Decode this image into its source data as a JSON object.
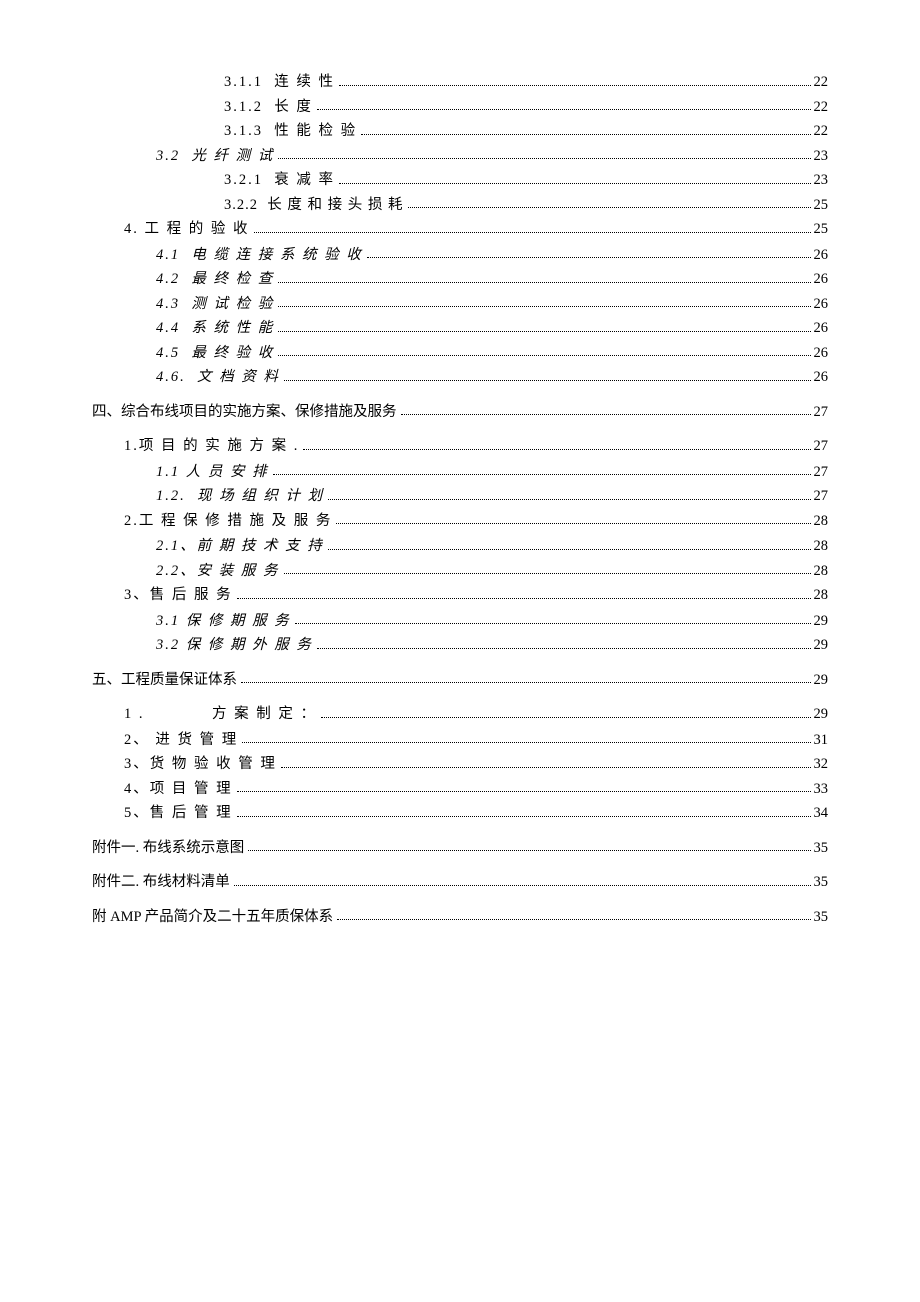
{
  "entries": [
    {
      "label": "3.1.1  连 续 性",
      "page": "22",
      "indent": 3,
      "italic": false,
      "section": false,
      "sp": "sp2"
    },
    {
      "label": "3.1.2  长 度",
      "page": "22",
      "indent": 3,
      "italic": false,
      "section": false,
      "sp": "sp2"
    },
    {
      "label": "3.1.3  性 能 检 验",
      "page": "22",
      "indent": 3,
      "italic": false,
      "section": false,
      "sp": "sp2"
    },
    {
      "label": "3.2  光 纤 测 试",
      "page": "23",
      "indent": 2,
      "italic": true,
      "section": false,
      "sp": "sp2"
    },
    {
      "label": "3.2.1  衰 减 率",
      "page": "23",
      "indent": 3,
      "italic": false,
      "section": false,
      "sp": "sp2"
    },
    {
      "label": "3.2.2  长 度 和 接 头 损 耗",
      "page": "25",
      "indent": 3,
      "italic": false,
      "section": false,
      "sp": "sp1"
    },
    {
      "label": "4. 工 程 的 验 收",
      "page": "25",
      "indent": 1,
      "italic": false,
      "section": false,
      "sp": "sp2",
      "group": true
    },
    {
      "label": "4.1  电 缆 连 接 系 统 验 收",
      "page": "26",
      "indent": 2,
      "italic": true,
      "section": false,
      "sp": "sp2"
    },
    {
      "label": "4.2  最 终 检 查",
      "page": "26",
      "indent": 2,
      "italic": true,
      "section": false,
      "sp": "sp2"
    },
    {
      "label": "4.3  测 试 检 验",
      "page": "26",
      "indent": 2,
      "italic": true,
      "section": false,
      "sp": "sp2"
    },
    {
      "label": "4.4  系 统 性 能",
      "page": "26",
      "indent": 2,
      "italic": true,
      "section": false,
      "sp": "sp2"
    },
    {
      "label": "4.5  最 终 验 收",
      "page": "26",
      "indent": 2,
      "italic": true,
      "section": false,
      "sp": "sp2"
    },
    {
      "label": "4.6.  文 档 资 料",
      "page": "26",
      "indent": 2,
      "italic": true,
      "section": false,
      "sp": "sp2"
    },
    {
      "label": "四、综合布线项目的实施方案、保修措施及服务",
      "page": "27",
      "indent": 0,
      "italic": false,
      "section": true,
      "sp": ""
    },
    {
      "label": "1.项 目 的 实 施 方 案 .",
      "page": "27",
      "indent": 1,
      "italic": false,
      "section": false,
      "sp": "sp2",
      "group": true
    },
    {
      "label": "1.1 人 员 安 排",
      "page": "27",
      "indent": 2,
      "italic": true,
      "section": false,
      "sp": "sp2"
    },
    {
      "label": "1.2.  现 场 组 织 计 划",
      "page": "27",
      "indent": 2,
      "italic": true,
      "section": false,
      "sp": "sp2"
    },
    {
      "label": "2.工 程 保 修 措 施 及 服 务",
      "page": "28",
      "indent": 1,
      "italic": false,
      "section": false,
      "sp": "sp2",
      "group": true
    },
    {
      "label": "2.1、前 期 技 术 支 持",
      "page": "28",
      "indent": 2,
      "italic": true,
      "section": false,
      "sp": "sp2"
    },
    {
      "label": "2.2、安 装 服 务",
      "page": "28",
      "indent": 2,
      "italic": true,
      "section": false,
      "sp": "sp2"
    },
    {
      "label": "3、售 后 服 务",
      "page": "28",
      "indent": 1,
      "italic": false,
      "section": false,
      "sp": "sp2",
      "group": true
    },
    {
      "label": "3.1 保 修 期 服 务",
      "page": "29",
      "indent": 2,
      "italic": true,
      "section": false,
      "sp": "sp2"
    },
    {
      "label": "3.2 保 修 期 外 服 务",
      "page": "29",
      "indent": 2,
      "italic": true,
      "section": false,
      "sp": "sp2"
    },
    {
      "label": "五、工程质量保证体系",
      "page": "29",
      "indent": 0,
      "italic": false,
      "section": true,
      "sp": ""
    },
    {
      "label": "1 .            方 案 制 定 ：",
      "page": "29",
      "indent": 1,
      "italic": false,
      "section": false,
      "sp": "sp2",
      "group": true
    },
    {
      "label": "2、 进 货 管 理",
      "page": "31",
      "indent": 1,
      "italic": false,
      "section": false,
      "sp": "sp2"
    },
    {
      "label": "3、货 物 验 收 管 理",
      "page": "32",
      "indent": 1,
      "italic": false,
      "section": false,
      "sp": "sp2"
    },
    {
      "label": "4、项 目 管 理",
      "page": "33",
      "indent": 1,
      "italic": false,
      "section": false,
      "sp": "sp2"
    },
    {
      "label": "5、售 后 管 理",
      "page": "34",
      "indent": 1,
      "italic": false,
      "section": false,
      "sp": "sp2"
    },
    {
      "label": "附件一. 布线系统示意图",
      "page": "35",
      "indent": 0,
      "italic": false,
      "section": true,
      "sp": ""
    },
    {
      "label": "附件二. 布线材料清单",
      "page": "35",
      "indent": 0,
      "italic": false,
      "section": true,
      "sp": ""
    },
    {
      "label": "附 AMP 产品简介及二十五年质保体系",
      "page": "35",
      "indent": 0,
      "italic": false,
      "section": true,
      "sp": ""
    }
  ]
}
